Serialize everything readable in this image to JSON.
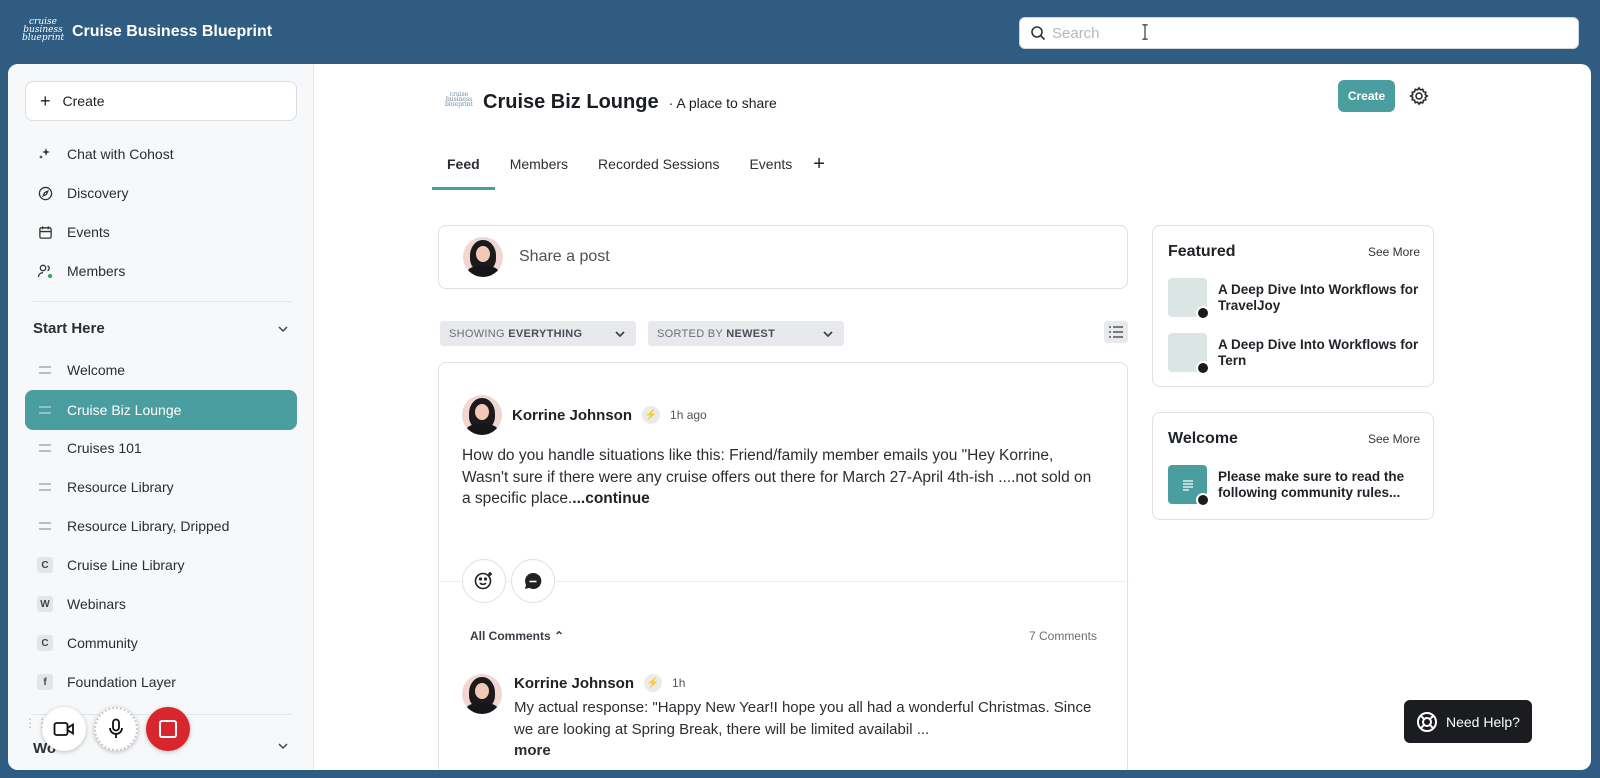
{
  "app": {
    "brand_logo_text": "cruise business blueprint",
    "title": "Cruise Business Blueprint"
  },
  "search": {
    "placeholder": "Search",
    "value": ""
  },
  "sidebar": {
    "create_label": "Create",
    "top_items": [
      {
        "label": "Chat with Cohost",
        "icon": "sparkle-icon"
      },
      {
        "label": "Discovery",
        "icon": "compass-icon"
      },
      {
        "label": "Events",
        "icon": "calendar-icon"
      },
      {
        "label": "Members",
        "icon": "members-icon"
      }
    ],
    "section_title": "Start Here",
    "space_items": [
      {
        "label": "Welcome",
        "icon": "chat-lines-icon"
      },
      {
        "label": "Cruise Biz Lounge",
        "icon": "chat-lines-icon",
        "active": true
      },
      {
        "label": "Cruises 101",
        "icon": "chat-lines-icon"
      },
      {
        "label": "Resource Library",
        "icon": "chat-lines-icon"
      },
      {
        "label": "Resource Library, Dripped",
        "icon": "chat-lines-icon"
      },
      {
        "label": "Cruise Line Library",
        "letter": "C"
      },
      {
        "label": "Webinars",
        "letter": "W"
      },
      {
        "label": "Community",
        "letter": "C"
      },
      {
        "label": "Foundation Layer",
        "letter": "f"
      }
    ],
    "next_section_partial": "Wo"
  },
  "group": {
    "logo_text": "cruise business blueprint",
    "title": "Cruise Biz Lounge",
    "subtitle": "· A place to share",
    "create_label": "Create",
    "tabs": [
      "Feed",
      "Members",
      "Recorded Sessions",
      "Events"
    ],
    "active_tab": "Feed"
  },
  "feed": {
    "share_placeholder": "Share a post",
    "filter_showing_prefix": "SHOWING",
    "filter_showing_value": "EVERYTHING",
    "filter_sort_prefix": "SORTED BY",
    "filter_sort_value": "NEWEST",
    "post": {
      "author": "Korrine Johnson",
      "time": "1h ago",
      "body": "How do you handle situations like this: Friend/family member emails you \"Hey Korrine, Wasn't sure if there were any cruise offers out there for March 27-April 4th-ish ....not sold on a specific place.",
      "continue_label": "...continue",
      "all_comments_label": "All Comments",
      "comment_count": "7 Comments",
      "comment": {
        "author": "Korrine Johnson",
        "time": "1h",
        "body": "My actual response: \"Happy New Year!I hope you all had a wonderful Christmas.  Since we are looking at Spring Break, there will be limited availabil ...",
        "more_label": "more"
      }
    }
  },
  "widgets": {
    "featured": {
      "title": "Featured",
      "see_more": "See More",
      "items": [
        {
          "title": "A Deep Dive Into Workflows for TravelJoy"
        },
        {
          "title": "A Deep Dive Into Workflows for Tern"
        }
      ]
    },
    "welcome": {
      "title": "Welcome",
      "see_more": "See More",
      "items": [
        {
          "title": "Please make sure to read the following community rules..."
        }
      ]
    }
  },
  "help": {
    "label": "Need Help?"
  },
  "colors": {
    "topbar": "#2f5c80",
    "accent": "#4b9ea0",
    "record": "#d7262e"
  }
}
